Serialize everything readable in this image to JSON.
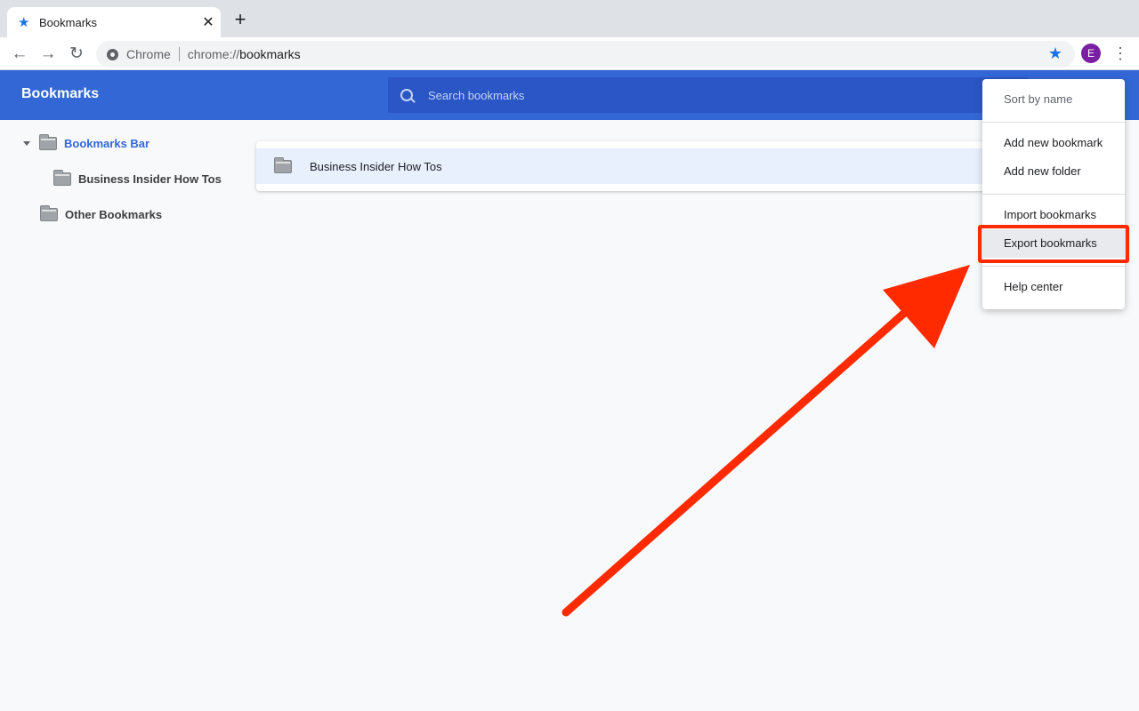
{
  "browser": {
    "tab": {
      "title": "Bookmarks",
      "icon": "star-icon",
      "close": "✕"
    },
    "new_tab": "+",
    "nav": {
      "back": "←",
      "forward": "→",
      "reload": "↻"
    },
    "omnibox": {
      "site_label": "Chrome",
      "scheme": "chrome://",
      "host": "bookmarks"
    },
    "star": "★",
    "avatar_initial": "E",
    "menu_dots": "⋮"
  },
  "app": {
    "title": "Bookmarks",
    "search_placeholder": "Search bookmarks"
  },
  "sidebar": {
    "items": [
      {
        "label": "Bookmarks Bar",
        "selected": true,
        "expanded": true
      },
      {
        "label": "Business Insider How Tos",
        "selected": false
      },
      {
        "label": "Other Bookmarks",
        "selected": false
      }
    ]
  },
  "list": {
    "items": [
      {
        "label": "Business Insider How Tos",
        "type": "folder"
      }
    ]
  },
  "menu": {
    "items": [
      {
        "label": "Sort by name",
        "disabled": true
      },
      {
        "label": "Add new bookmark"
      },
      {
        "label": "Add new folder"
      },
      {
        "label": "Import bookmarks"
      },
      {
        "label": "Export bookmarks",
        "highlighted": true
      },
      {
        "label": "Help center"
      }
    ]
  },
  "annotation": {
    "color": "#ff2a00",
    "target": "Export bookmarks"
  }
}
